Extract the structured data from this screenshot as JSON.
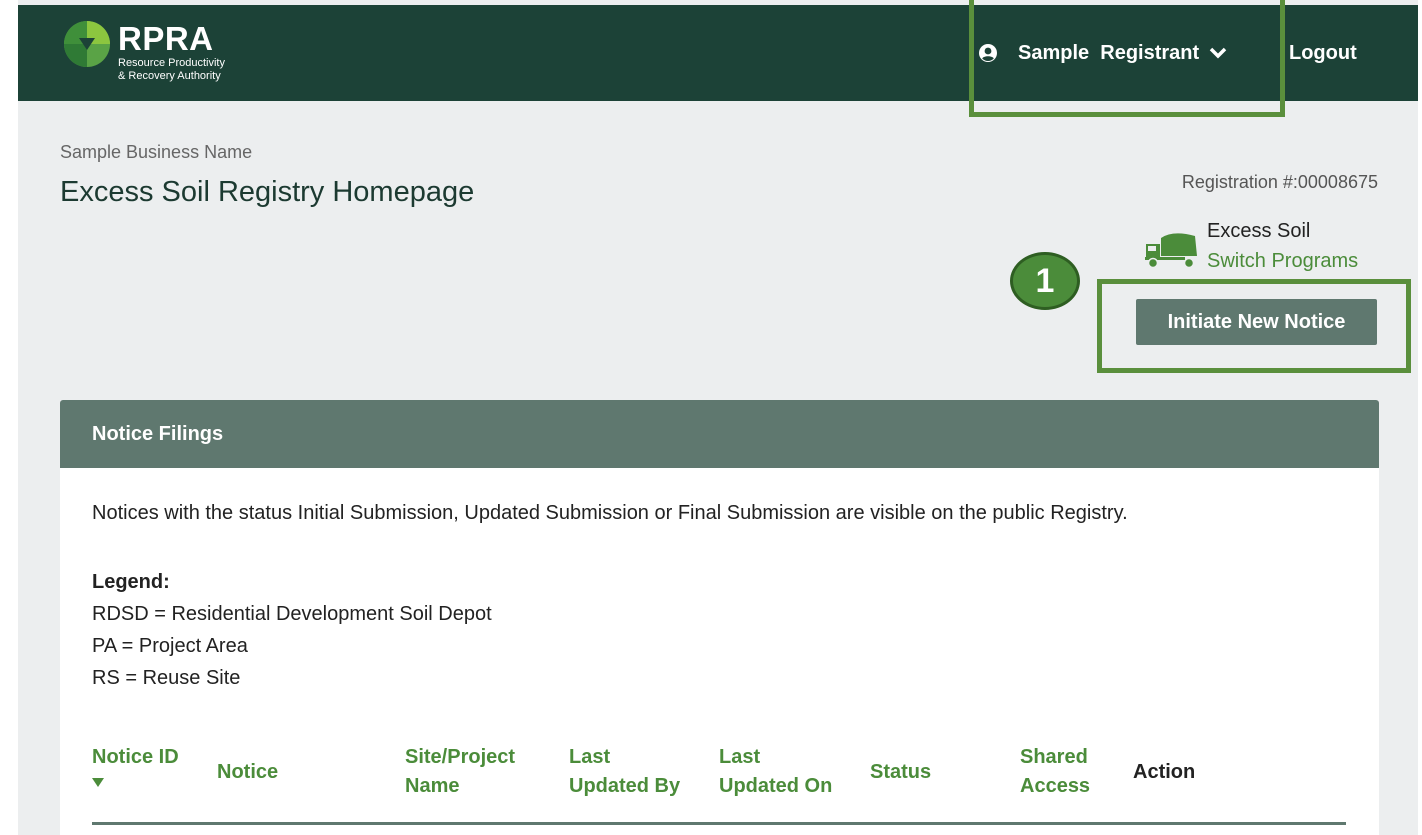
{
  "header": {
    "logo": {
      "wordmark": "RPRA",
      "subtitle_line1": "Resource Productivity",
      "subtitle_line2": "& Recovery Authority"
    },
    "user_name": "Sample  Registrant",
    "logout_label": "Logout"
  },
  "business_name": "Sample Business Name",
  "page_title": "Excess Soil Registry Homepage",
  "registration_label": "Registration #:00008675",
  "program": {
    "name": "Excess Soil",
    "switch_label": "Switch Programs"
  },
  "step_number": "1",
  "initiate_button_label": "Initiate New Notice",
  "panel": {
    "title": "Notice Filings",
    "note": "Notices with the status Initial Submission, Updated Submission or Final Submission are visible on the public Registry.",
    "legend_title": "Legend:",
    "legend_items": [
      "RDSD = Residential Development Soil Depot",
      "PA = Project Area",
      "RS = Reuse Site"
    ]
  },
  "table": {
    "columns": [
      {
        "line1": "Notice ID",
        "line2": ""
      },
      {
        "line1": "Notice",
        "line2": ""
      },
      {
        "line1": "Site/Project",
        "line2": "Name"
      },
      {
        "line1": "Last",
        "line2": "Updated By"
      },
      {
        "line1": "Last",
        "line2": "Updated On"
      },
      {
        "line1": "Status",
        "line2": ""
      },
      {
        "line1": "Shared",
        "line2": "Access"
      },
      {
        "line1": "Action",
        "line2": ""
      }
    ]
  },
  "colors": {
    "header_bg": "#1c4237",
    "accent_green": "#4b8c3a",
    "panel_header": "#5f786f",
    "callout_border": "#5a8f3c"
  }
}
